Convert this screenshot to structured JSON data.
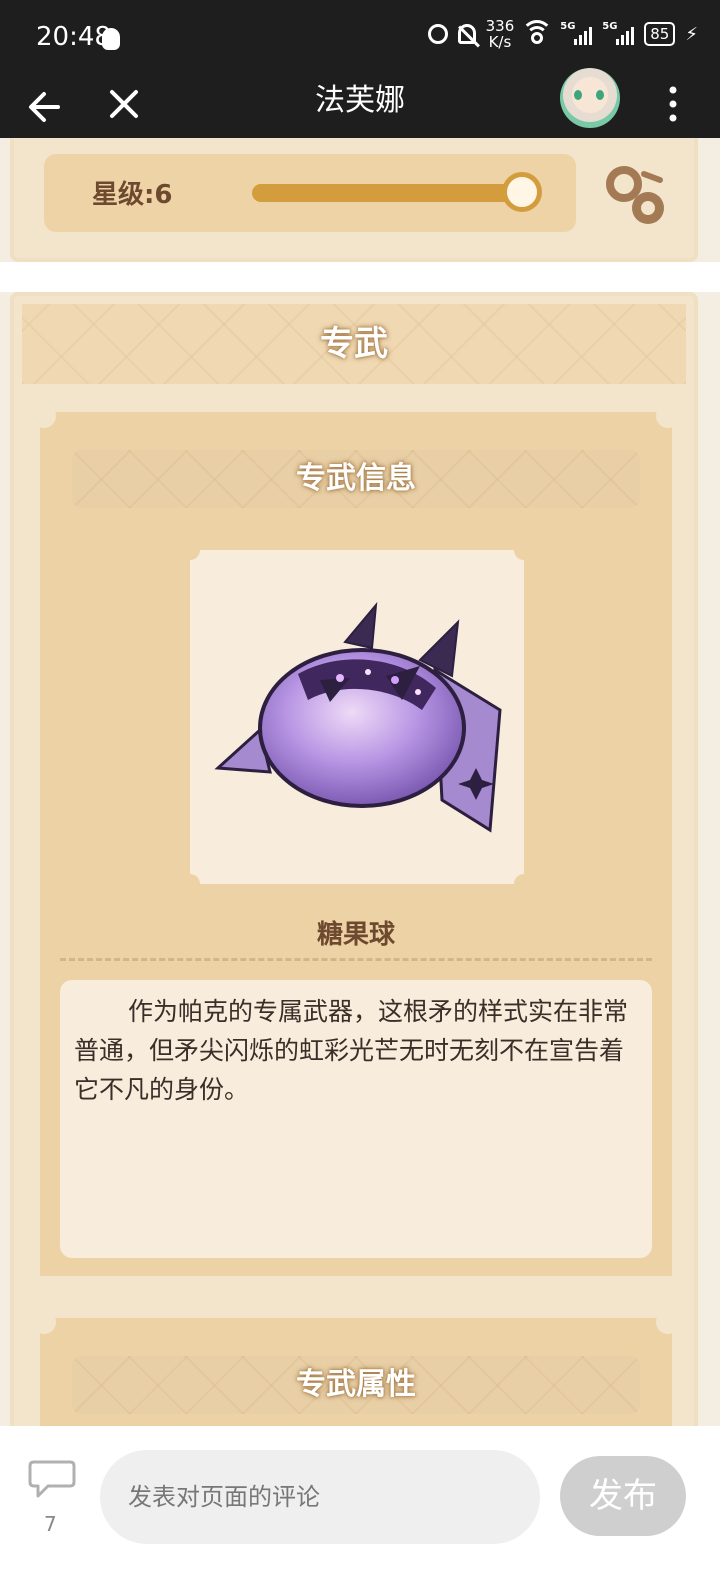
{
  "status_bar": {
    "time": "20:48",
    "net_speed_value": "336",
    "net_speed_unit": "K/s",
    "battery": "85",
    "signal_1_label": "5G",
    "signal_2_label": "5G"
  },
  "header": {
    "title": "法芙娜"
  },
  "star": {
    "label": "星级:6",
    "level": 6,
    "slider_fill": 1.0
  },
  "section": {
    "title": "专武",
    "info_title": "专武信息",
    "weapon_name": "糖果球",
    "description": "作为帕克的专属武器，这根矛的样式实在非常普通，但矛尖闪烁的虹彩光芒无时无刻不在宣告着它不凡的身份。",
    "attr_title": "专武属性"
  },
  "comment": {
    "count": "7",
    "placeholder": "发表对页面的评论",
    "publish_label": "发布"
  },
  "colors": {
    "accent": "#d39d3d",
    "panel": "#edd2a6",
    "card": "#f3e4cc"
  }
}
